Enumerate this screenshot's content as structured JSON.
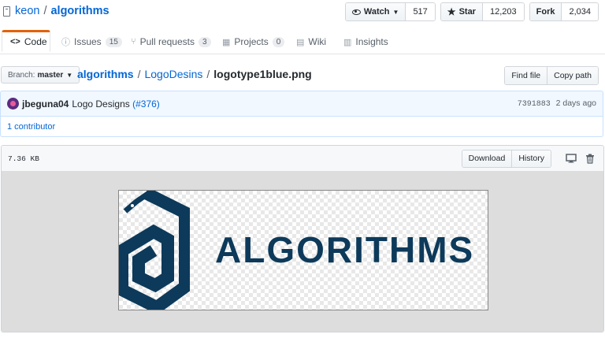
{
  "repo": {
    "owner": "keon",
    "separator": "/",
    "name": "algorithms"
  },
  "actions": {
    "watch": {
      "label": "Watch",
      "count": "517"
    },
    "star": {
      "label": "Star",
      "count": "12,203"
    },
    "fork": {
      "label": "Fork",
      "count": "2,034"
    }
  },
  "tabs": [
    {
      "label": "Code",
      "icon": "code-icon",
      "active": true
    },
    {
      "label": "Issues",
      "icon": "issue-icon",
      "count": "15"
    },
    {
      "label": "Pull requests",
      "icon": "pull-request-icon",
      "count": "3"
    },
    {
      "label": "Projects",
      "icon": "project-icon",
      "count": "0"
    },
    {
      "label": "Wiki",
      "icon": "book-icon"
    },
    {
      "label": "Insights",
      "icon": "graph-icon"
    }
  ],
  "branch": {
    "label": "Branch:",
    "value": "master"
  },
  "breadcrumb": {
    "root": "algorithms",
    "folder": "LogoDesins",
    "file": "logotype1blue.png",
    "sep": "/"
  },
  "file_actions": {
    "find": "Find file",
    "copy": "Copy path"
  },
  "commit": {
    "author": "jbeguna04",
    "message": "Logo Designs",
    "pr": "(#376)",
    "sha": "7391883",
    "time": "2 days ago"
  },
  "contributors": "1 contributor",
  "file": {
    "size": "7.36 KB",
    "download": "Download",
    "history": "History",
    "logo_text": "ALGORITHMS"
  },
  "colors": {
    "logo": "#0d3a5a",
    "tab_accent": "#e36209",
    "link": "#0366d6"
  }
}
